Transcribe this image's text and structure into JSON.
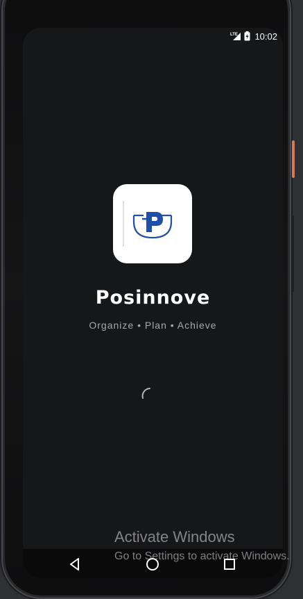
{
  "status_bar": {
    "network_label": "LTE",
    "time": "10:02"
  },
  "app": {
    "name": "Posinnove",
    "tagline": "Organize • Plan • Achieve",
    "logo_letter": "P",
    "brand_color": "#1f4fa8",
    "background_color": "#161718"
  },
  "loading": {
    "indicator": "spinner"
  },
  "nav_bar": {
    "back_icon": "triangle-back-icon",
    "home_icon": "circle-home-icon",
    "recents_icon": "square-recents-icon"
  },
  "watermark": {
    "title": "Activate Windows",
    "subtitle": "Go to Settings to activate Windows."
  }
}
